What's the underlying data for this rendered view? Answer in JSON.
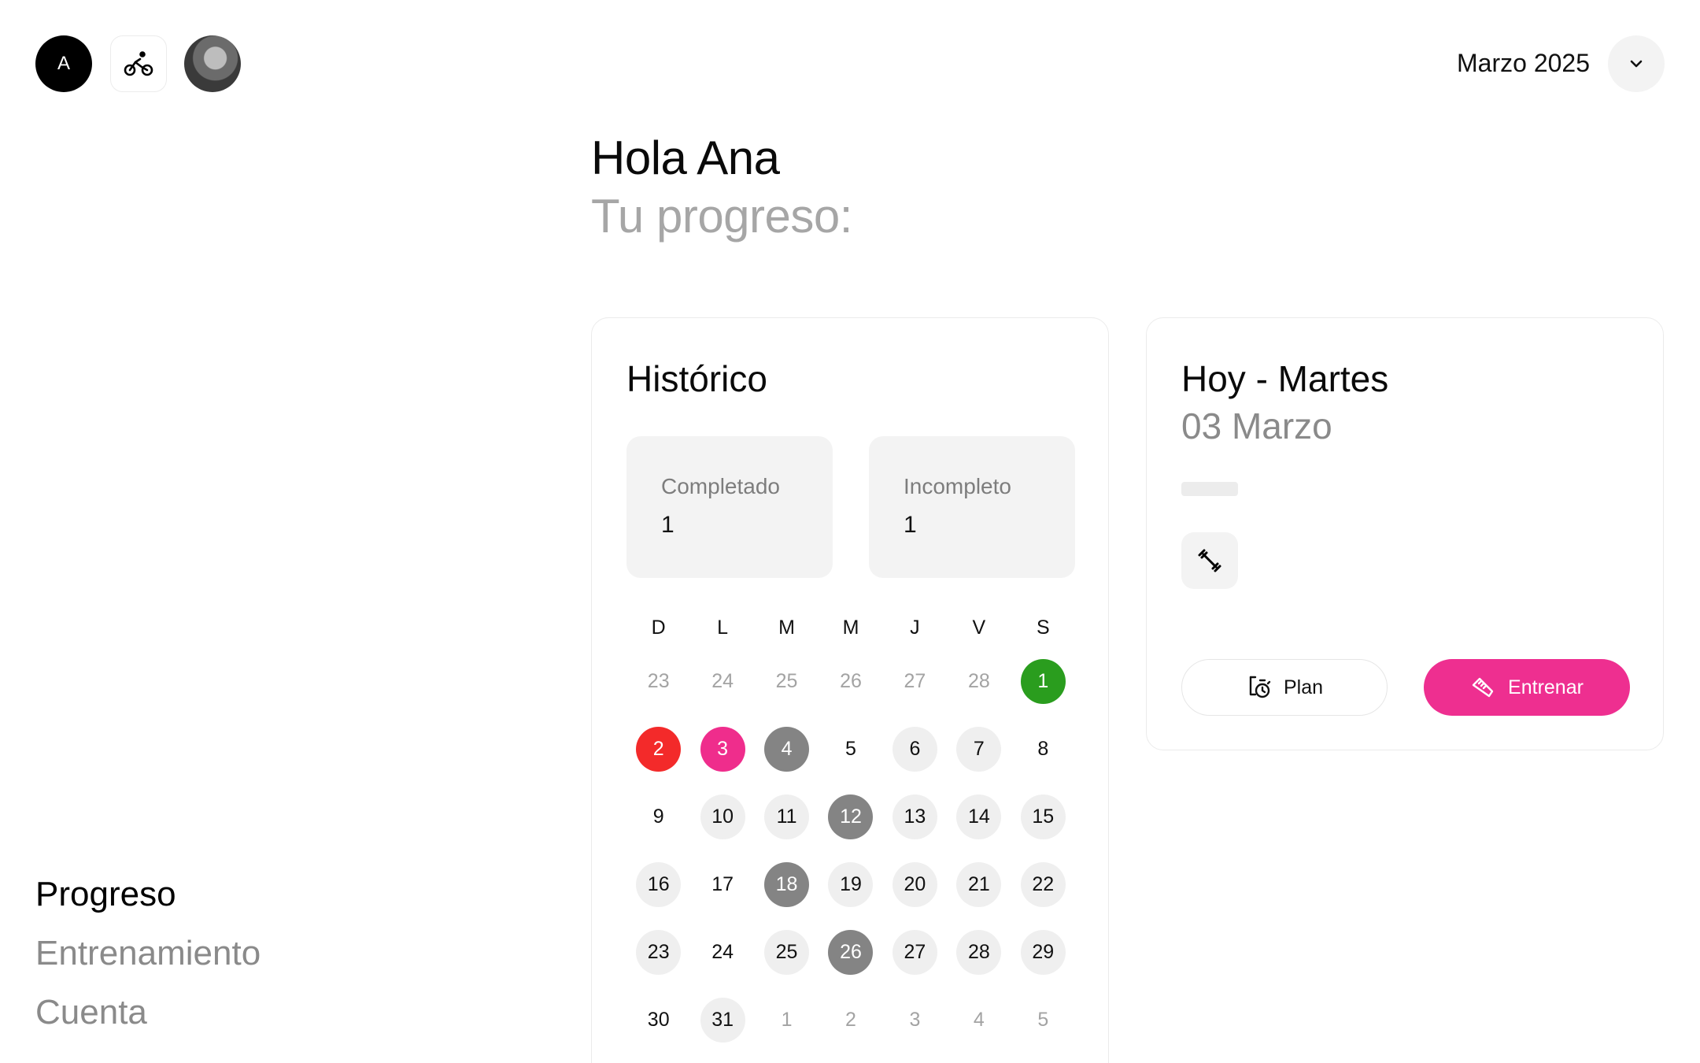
{
  "header": {
    "avatar_letter": "A",
    "month_label": "Marzo 2025"
  },
  "greeting": {
    "title": "Hola Ana",
    "subtitle": "Tu progreso:"
  },
  "nav": {
    "items": [
      {
        "label": "Progreso",
        "active": true
      },
      {
        "label": "Entrenamiento",
        "active": false
      },
      {
        "label": "Cuenta",
        "active": false
      }
    ]
  },
  "historico": {
    "title": "Histórico",
    "completed": {
      "label": "Completado",
      "value": "1"
    },
    "incomplete": {
      "label": "Incompleto",
      "value": "1"
    },
    "weekdays": [
      "D",
      "L",
      "M",
      "M",
      "J",
      "V",
      "S"
    ],
    "weeks": [
      [
        {
          "d": "23",
          "s": "muted"
        },
        {
          "d": "24",
          "s": "muted"
        },
        {
          "d": "25",
          "s": "muted"
        },
        {
          "d": "26",
          "s": "muted"
        },
        {
          "d": "27",
          "s": "muted"
        },
        {
          "d": "28",
          "s": "muted"
        },
        {
          "d": "1",
          "s": "green"
        }
      ],
      [
        {
          "d": "2",
          "s": "red"
        },
        {
          "d": "3",
          "s": "pink"
        },
        {
          "d": "4",
          "s": "dark"
        },
        {
          "d": "5",
          "s": "plain"
        },
        {
          "d": "6",
          "s": "light"
        },
        {
          "d": "7",
          "s": "light"
        },
        {
          "d": "8",
          "s": "plain"
        }
      ],
      [
        {
          "d": "9",
          "s": "plain"
        },
        {
          "d": "10",
          "s": "light"
        },
        {
          "d": "11",
          "s": "light"
        },
        {
          "d": "12",
          "s": "dark"
        },
        {
          "d": "13",
          "s": "light"
        },
        {
          "d": "14",
          "s": "light"
        },
        {
          "d": "15",
          "s": "light"
        }
      ],
      [
        {
          "d": "16",
          "s": "light"
        },
        {
          "d": "17",
          "s": "plain"
        },
        {
          "d": "18",
          "s": "dark"
        },
        {
          "d": "19",
          "s": "light"
        },
        {
          "d": "20",
          "s": "light"
        },
        {
          "d": "21",
          "s": "light"
        },
        {
          "d": "22",
          "s": "light"
        }
      ],
      [
        {
          "d": "23",
          "s": "light"
        },
        {
          "d": "24",
          "s": "plain"
        },
        {
          "d": "25",
          "s": "light"
        },
        {
          "d": "26",
          "s": "dark"
        },
        {
          "d": "27",
          "s": "light"
        },
        {
          "d": "28",
          "s": "light"
        },
        {
          "d": "29",
          "s": "light"
        }
      ],
      [
        {
          "d": "30",
          "s": "plain"
        },
        {
          "d": "31",
          "s": "light"
        },
        {
          "d": "1",
          "s": "muted"
        },
        {
          "d": "2",
          "s": "muted"
        },
        {
          "d": "3",
          "s": "muted"
        },
        {
          "d": "4",
          "s": "muted"
        },
        {
          "d": "5",
          "s": "muted"
        }
      ]
    ]
  },
  "today": {
    "title": "Hoy - Martes",
    "date": "03 Marzo",
    "workout_icon": "dumbbell-icon",
    "plan_label": "Plan",
    "train_label": "Entrenar"
  },
  "colors": {
    "accent": "#ee2f90",
    "completed": "#2a9d1e",
    "missed": "#f32a2a",
    "rest": "#848484"
  }
}
